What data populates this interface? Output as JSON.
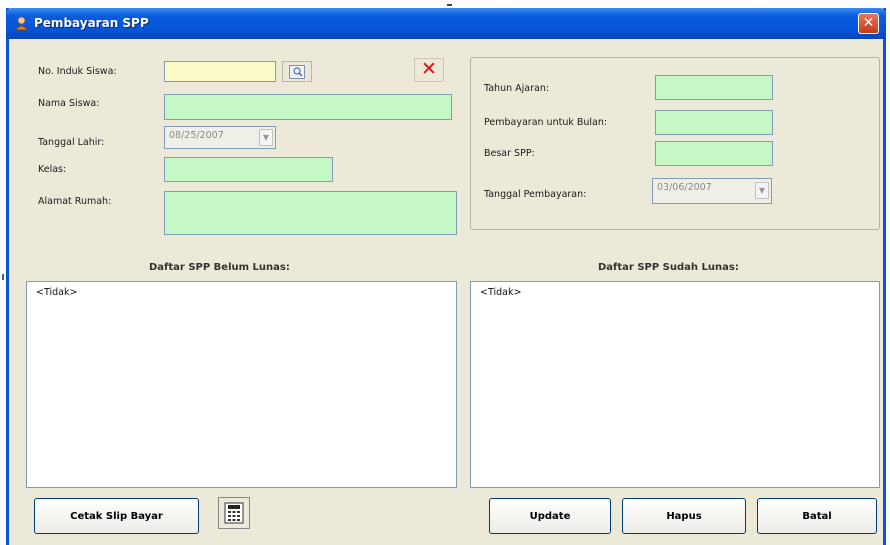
{
  "window": {
    "title": "Pembayaran SPP",
    "close_label": "✕"
  },
  "student": {
    "nis_label": "No. Induk Siswa:",
    "nis_value": "",
    "name_label": "Nama Siswa:",
    "name_value": "",
    "birthdate_label": "Tanggal Lahir:",
    "birthdate_value": "08/25/2007",
    "class_label": "Kelas:",
    "class_value": "",
    "address_label": "Alamat Rumah:",
    "address_value": "",
    "clear_label": "✕"
  },
  "payment": {
    "year_label": "Tahun Ajaran:",
    "year_value": "",
    "month_label": "Pembayaran untuk Bulan:",
    "month_value": "",
    "fee_label": "Besar SPP:",
    "fee_value": "",
    "date_label": "Tanggal Pembayaran:",
    "date_value": "03/06/2007"
  },
  "lists": {
    "unpaid_title": "Daftar SPP Belum Lunas:",
    "unpaid_items": [
      "<Tidak>"
    ],
    "paid_title": "Daftar SPP Sudah Lunas:",
    "paid_items": [
      "<Tidak>"
    ]
  },
  "buttons": {
    "print_label": "Cetak Slip Bayar",
    "update_label": "Update",
    "delete_label": "Hapus",
    "cancel_label": "Batal"
  },
  "colors": {
    "title_bar": "#0654d8",
    "field_green": "#c6f7c6",
    "field_yellow": "#fafac8",
    "close_red": "#e01010"
  },
  "icons": {
    "title": "user-icon",
    "lookup": "search-icon",
    "clear": "close-icon",
    "calculator": "calculator-icon"
  }
}
